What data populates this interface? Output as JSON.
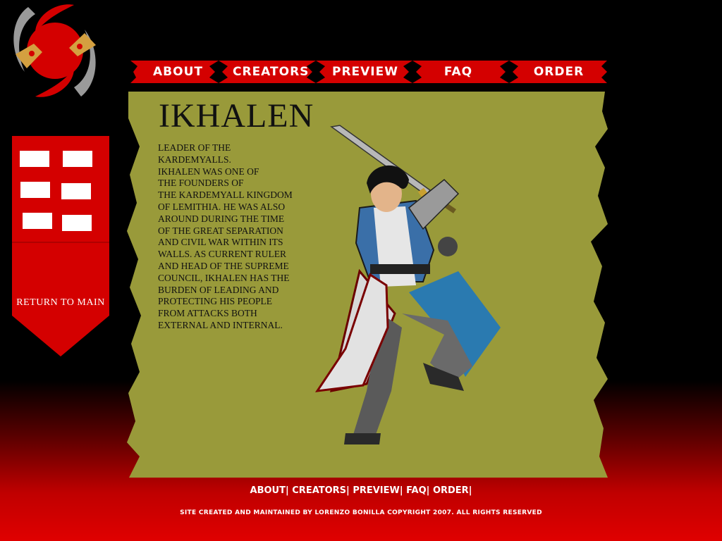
{
  "nav": {
    "items": [
      "ABOUT",
      "CREATORS",
      "PREVIEW",
      "FAQ",
      "ORDER"
    ]
  },
  "sidebar": {
    "return_label": "RETURN TO MAIN"
  },
  "character": {
    "name": "IKHALEN",
    "bio": "LEADER OF THE\nKARDEMYALLS.\nIKHALEN WAS ONE OF\nTHE FOUNDERS OF\nTHE KARDEMYALL KINGDOM\nOF LEMITHIA. HE WAS ALSO\nAROUND DURING THE TIME\nOF THE GREAT SEPARATION\nAND CIVIL WAR WITHIN ITS\nWALLS.  AS CURRENT RULER\nAND HEAD OF THE SUPREME\nCOUNCIL, IKHALEN HAS THE\nBURDEN OF LEADING AND\nPROTECTING HIS PEOPLE\nFROM ATTACKS BOTH\nEXTERNAL AND INTERNAL."
  },
  "footer": {
    "links": [
      "ABOUT",
      "CREATORS",
      "PREVIEW",
      "FAQ",
      "ORDER"
    ],
    "separator": "|",
    "copyright": "SITE CREATED AND MAINTAINED BY  LORENZO BONILLA COPYRIGHT 2007. ALL RIGHTS RESERVED"
  },
  "colors": {
    "brand_red": "#d40000",
    "parchment": "#999a3a",
    "background": "#000000"
  }
}
